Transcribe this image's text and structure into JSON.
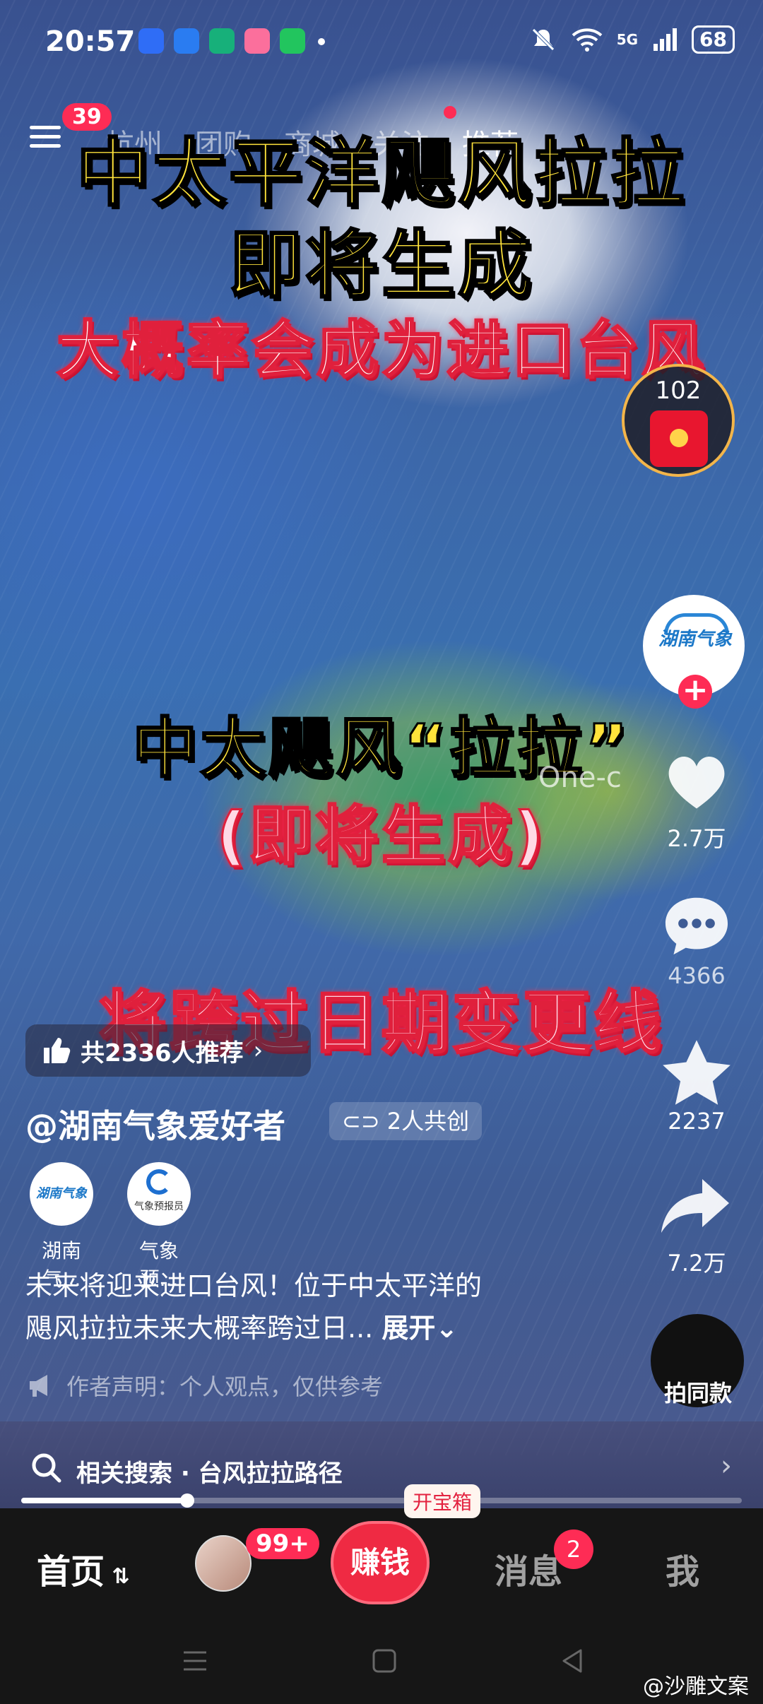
{
  "status_bar": {
    "time": "20:57",
    "network": "5G",
    "battery": "68"
  },
  "top_nav": {
    "menu_badge": "39",
    "tabs": [
      "杭州",
      "团购",
      "商城",
      "关注",
      "推荐"
    ]
  },
  "video_overlay": {
    "line1": "中太平洋飓风拉拉",
    "line2": "即将生成",
    "line3": "大概率会成为进口台风",
    "line4": "中太飓风“拉拉”",
    "line5": "(即将生成)",
    "line6": "将跨过日期变更线",
    "watermark": "One-c"
  },
  "red_packet": {
    "count": "102"
  },
  "actions": {
    "likes": "2.7万",
    "comments": "4366",
    "favorites": "2237",
    "shares": "7.2万",
    "same_style": "拍同款"
  },
  "recommend_pill": "共2336人推荐",
  "author": {
    "handle": "@湖南气象爱好者",
    "cocreate": "2人共创",
    "avatar_logo": "湖南气象"
  },
  "co_creators": [
    {
      "name": "湖南气...",
      "logo": "湖南气象"
    },
    {
      "name": "气象预...",
      "logo": "气象预报员"
    }
  ],
  "caption": {
    "line1": "未来将迎来进口台风！位于中太平洋的",
    "line2": "飓风拉拉未来大概率跨过日...",
    "expand": "展开"
  },
  "disclaimer": "作者声明：个人观点，仅供参考",
  "related_search": "相关搜索 · 台风拉拉路径",
  "progress": 0.23,
  "bottom_nav": {
    "home": "首页",
    "friends_badge": "99+",
    "earn": "赚钱",
    "earn_bubble": "开宝箱",
    "messages": "消息",
    "messages_badge": "2",
    "me": "我"
  },
  "corner_watermark": "@沙雕文案",
  "colors": {
    "accent_red": "#fe2c55",
    "headline_yellow": "#ffe33b"
  }
}
